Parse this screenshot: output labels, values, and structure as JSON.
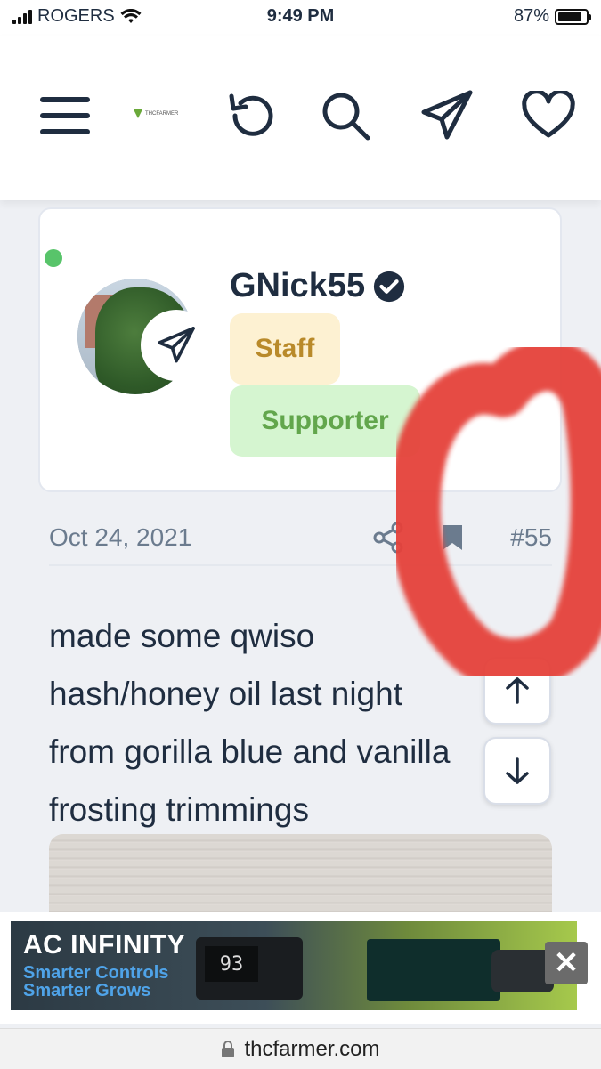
{
  "status_bar": {
    "carrier": "ROGERS",
    "time": "9:49 PM",
    "battery": "87%",
    "battery_level": 0.87
  },
  "navbar": {
    "logo_text": "THCFARMER",
    "icons": [
      "menu-icon",
      "refresh-icon",
      "search-icon",
      "send-icon",
      "heart-icon"
    ]
  },
  "user_card": {
    "username": "GNick55",
    "badges": [
      "Staff",
      "Supporter"
    ],
    "online": true,
    "colors": {
      "staff_bg": "#fdf1d2",
      "staff_text": "#b98a2a",
      "supporter_bg": "#d5f5d0",
      "supporter_text": "#62a64c",
      "online": "#58c46a"
    }
  },
  "post": {
    "date": "Oct 24, 2021",
    "number": "#55",
    "lines": [
      "made some qwiso",
      "hash/honey oil last night",
      "from gorilla blue and vanilla",
      "frosting trimmings"
    ]
  },
  "ad": {
    "title": "AC INFINITY",
    "line1": "Smarter Controls",
    "line2": "Smarter Grows",
    "display_value": "93"
  },
  "url_bar": {
    "domain": "thcfarmer.com"
  }
}
